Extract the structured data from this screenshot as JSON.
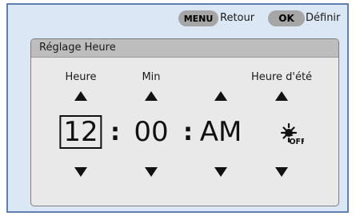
{
  "topbar": {
    "menu_key": "MENU",
    "menu_action": "Retour",
    "ok_key": "OK",
    "ok_action": "Définir"
  },
  "panel": {
    "title": "Réglage Heure",
    "columns": {
      "hour": {
        "label": "Heure",
        "value": "12"
      },
      "minute": {
        "label": "Min",
        "value": "00"
      },
      "ampm": {
        "label": "",
        "value": "AM"
      },
      "dst": {
        "label": "Heure d'été",
        "value": "OFF"
      }
    },
    "separator": ":"
  }
}
